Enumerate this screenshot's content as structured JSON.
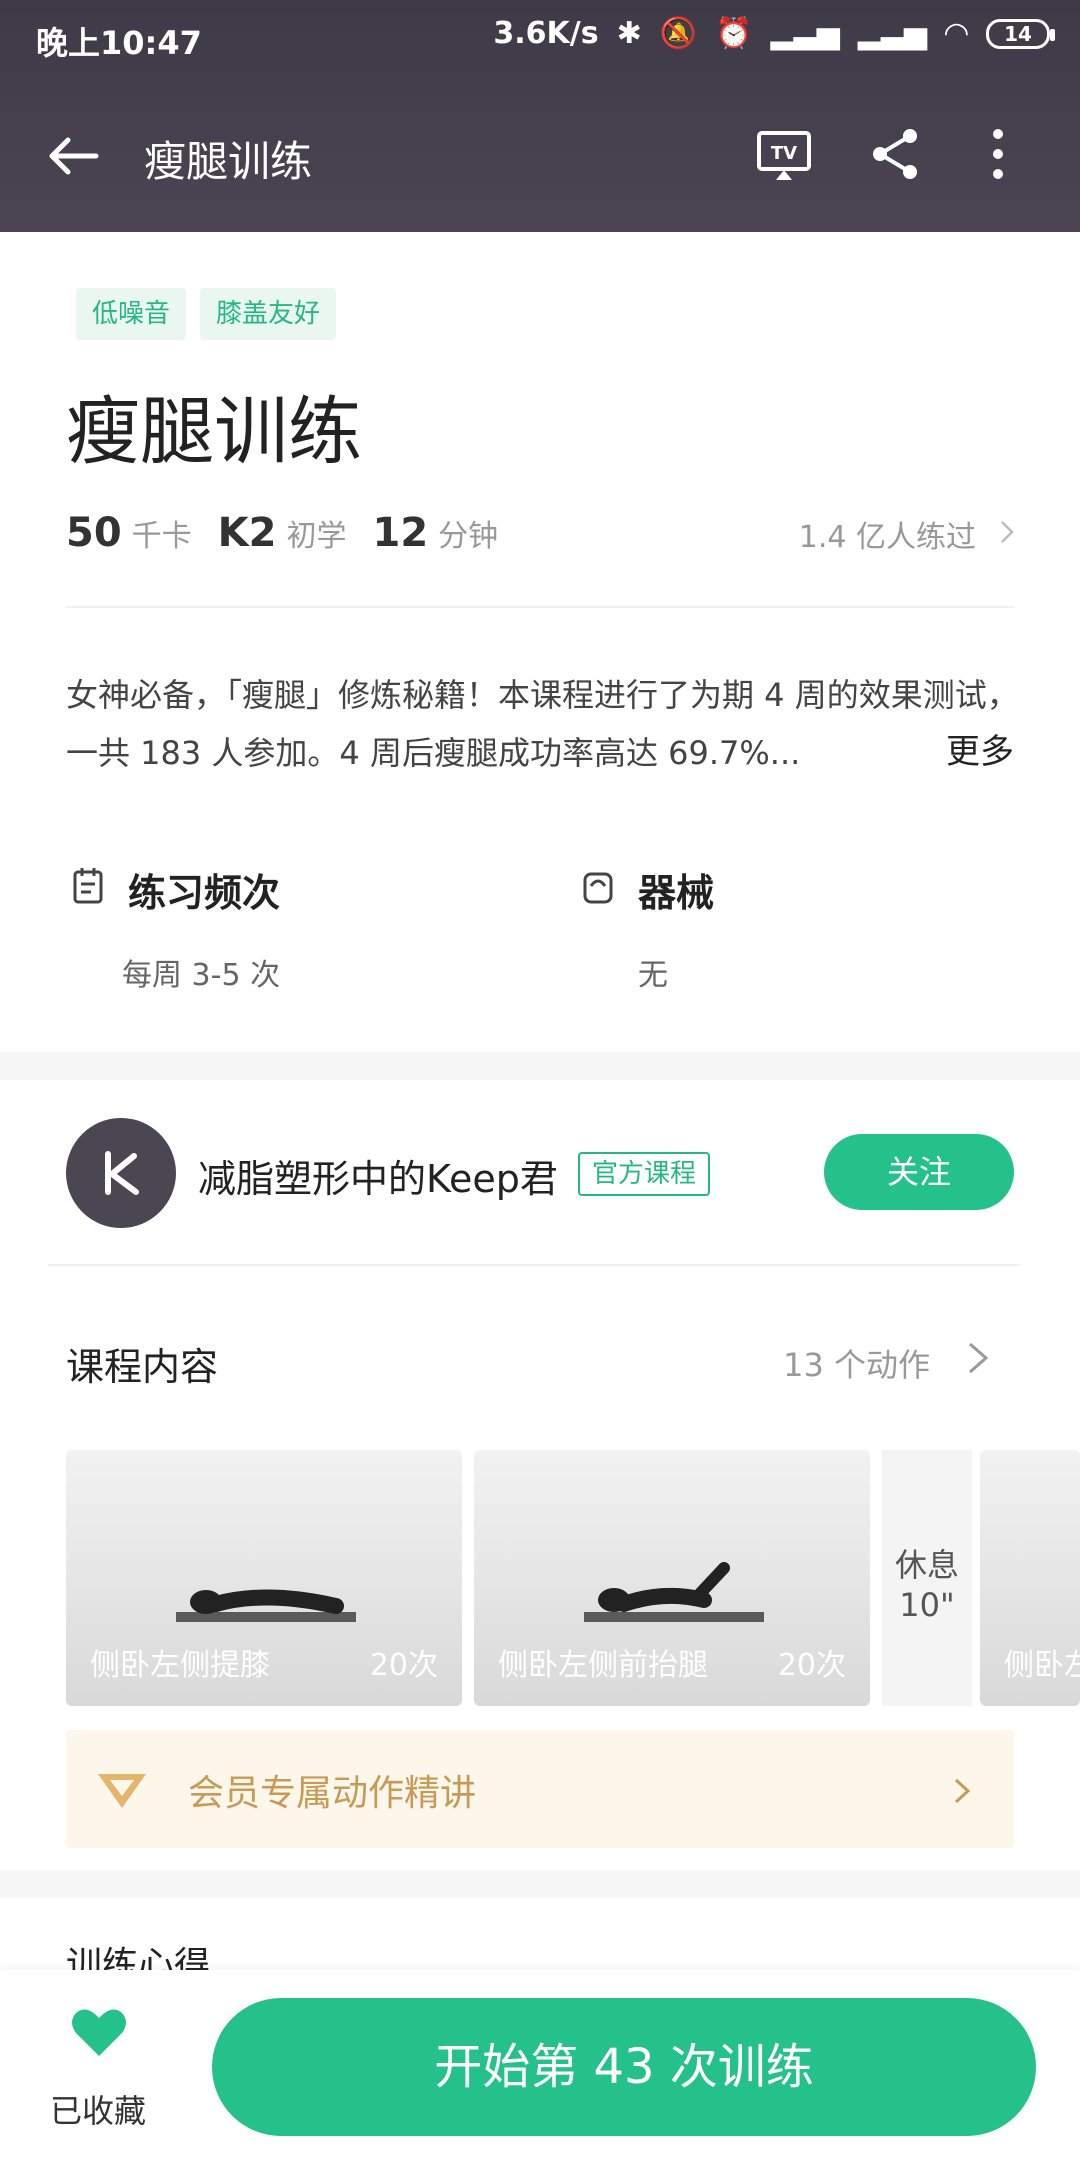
{
  "status_bar": {
    "time": "晚上10:47",
    "network_speed": "3.6K/s",
    "battery": "14"
  },
  "header": {
    "title": "瘦腿训练"
  },
  "course": {
    "tags": [
      "低噪音",
      "膝盖友好"
    ],
    "title": "瘦腿训练",
    "stats": {
      "calories_num": "50",
      "calories_unit": "千卡",
      "level_num": "K2",
      "level_label": "初学",
      "minutes_num": "12",
      "minutes_unit": "分钟"
    },
    "people": "1.4 亿人练过",
    "description": "女神必备，「瘦腿」修炼秘籍！本课程进行了为期 4 周的效果测试，一共 183 人参加。4 周后瘦腿成功率高达 69.7%...",
    "more": "更多",
    "frequency_title": "练习频次",
    "frequency_value": "每周 3-5 次",
    "equipment_title": "器械",
    "equipment_value": "无"
  },
  "author": {
    "name": "减脂塑形中的Keep君",
    "badge": "官方课程",
    "follow": "关注"
  },
  "content": {
    "title": "课程内容",
    "count": "13 个动作",
    "exercises": [
      {
        "name": "侧卧左侧提膝",
        "reps": "20次"
      },
      {
        "name": "侧卧左侧前抬腿",
        "reps": "20次"
      },
      {
        "name": "侧卧左",
        "reps": ""
      }
    ],
    "rest_label": "休息",
    "rest_time": "10\""
  },
  "member": {
    "text": "会员专属动作精讲"
  },
  "partial_section_title": "训练心得",
  "bottom": {
    "favorite_label": "已收藏",
    "start_button": "开始第 43 次训练"
  },
  "colors": {
    "accent_green": "#24c18a",
    "header_bg": "#443f4c",
    "gold": "#c79b55"
  }
}
